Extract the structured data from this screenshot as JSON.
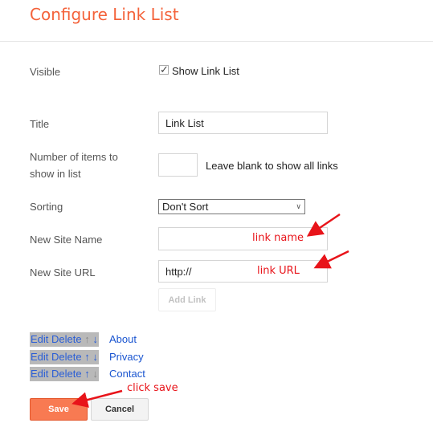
{
  "title": "Configure Link List",
  "form": {
    "visible_label": "Visible",
    "show_checkbox_label": "Show Link List",
    "show_checked": true,
    "title_label": "Title",
    "title_value": "Link List",
    "items_label_line1": "Number of items to",
    "items_label_line2": "show in list",
    "items_value": "",
    "items_hint": "Leave blank to show all links",
    "sorting_label": "Sorting",
    "sorting_value": "Don't Sort",
    "site_name_label": "New Site Name",
    "site_name_value": "",
    "site_url_label": "New Site URL",
    "site_url_value": "http://",
    "add_link": "Add Link"
  },
  "links": [
    {
      "edit": "Edit",
      "delete": "Delete",
      "up": "↑",
      "down": "↓",
      "name": "About"
    },
    {
      "edit": "Edit",
      "delete": "Delete",
      "up": "↑",
      "down": "↓",
      "name": "Privacy"
    },
    {
      "edit": "Edit",
      "delete": "Delete",
      "up": "↑",
      "down": "↓",
      "name": "Contact"
    }
  ],
  "annotations": {
    "link_name": "link name",
    "link_url": "link URL",
    "click_save": "click save"
  },
  "buttons": {
    "save": "Save",
    "cancel": "Cancel"
  },
  "colors": {
    "accent": "#f4623a",
    "annotation": "#e8141a",
    "link": "#1a55d0"
  }
}
